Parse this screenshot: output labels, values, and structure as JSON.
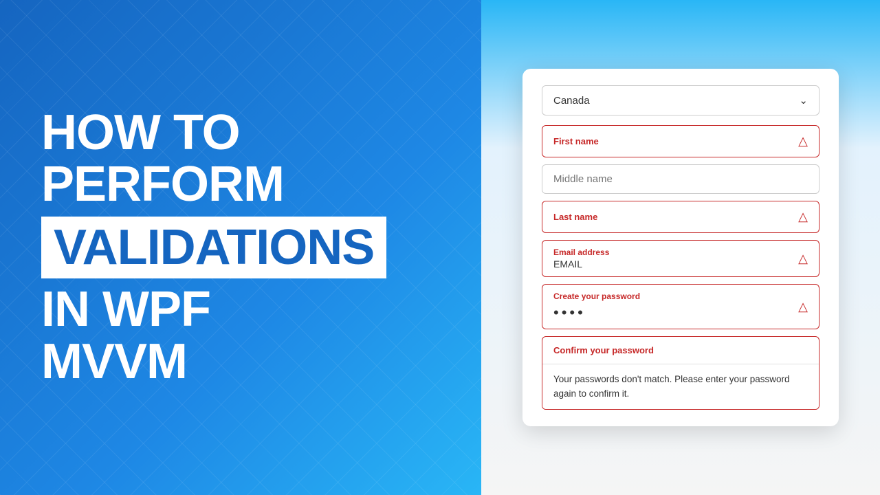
{
  "left": {
    "line1": "HOW TO",
    "line2": "PERFORM",
    "highlight": "VALIDATIONS",
    "line3": "IN WPF",
    "line4": "MVVM"
  },
  "form": {
    "country": {
      "value": "Canada",
      "chevron": "⌄"
    },
    "first_name": {
      "placeholder": "First name",
      "error": true
    },
    "middle_name": {
      "placeholder": "Middle name",
      "error": false
    },
    "last_name": {
      "placeholder": "Last name",
      "error": true
    },
    "email": {
      "label": "Email address",
      "value": "EMAIL",
      "error": true
    },
    "create_password": {
      "label": "Create your password",
      "dots": "••••",
      "error": true
    },
    "confirm_password": {
      "label": "Confirm your password",
      "error_message": "Your passwords don't match. Please enter your password again to confirm it.",
      "error": true
    }
  },
  "icons": {
    "warning": "⚠",
    "chevron_down": "∨"
  }
}
